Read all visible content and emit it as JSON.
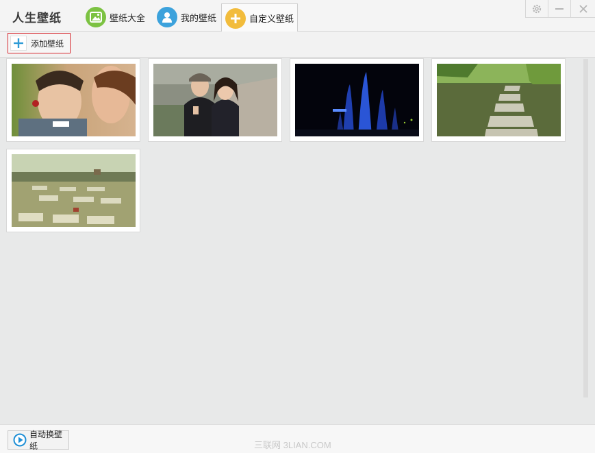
{
  "app": {
    "title": "人生壁纸"
  },
  "tabs": [
    {
      "label": "壁纸大全",
      "icon": "picture-icon",
      "color": "#7cc242"
    },
    {
      "label": "我的壁纸",
      "icon": "user-icon",
      "color": "#3ca2dc"
    },
    {
      "label": "自定义壁纸",
      "icon": "plus-icon",
      "color": "#f2bc3c",
      "active": true
    }
  ],
  "window_controls": {
    "settings": "gear-icon",
    "minimize": "minimize-icon",
    "close": "close-icon"
  },
  "toolbar": {
    "add_label": "添加壁纸"
  },
  "wallpapers": [
    {
      "name": "wedding-couple"
    },
    {
      "name": "couple-peace-sign"
    },
    {
      "name": "blue-fountain-night"
    },
    {
      "name": "stepping-stones-pond"
    },
    {
      "name": "field-stone-path"
    }
  ],
  "bottom": {
    "auto_label": "自动换壁纸",
    "watermark": "三联网 3LIAN.COM"
  }
}
